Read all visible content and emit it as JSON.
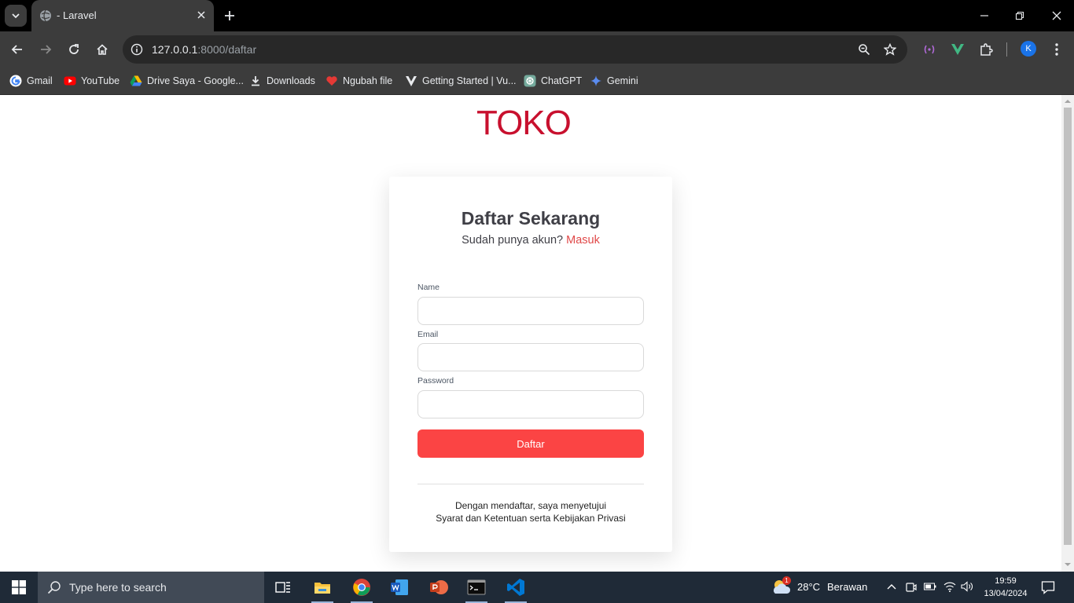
{
  "browser": {
    "tab_title": "- Laravel",
    "url_host": "127.0.0.1",
    "url_rest": ":8000/daftar",
    "profile_initial": "K",
    "bookmarks": [
      {
        "label": "Gmail",
        "icon": "gmail-icon"
      },
      {
        "label": "YouTube",
        "icon": "youtube-icon"
      },
      {
        "label": "Drive Saya - Google...",
        "icon": "google-drive-icon"
      },
      {
        "label": "Downloads",
        "icon": "download-icon"
      },
      {
        "label": "Ngubah file",
        "icon": "heart-icon"
      },
      {
        "label": "Getting Started | Vu...",
        "icon": "vuetify-icon"
      },
      {
        "label": "ChatGPT",
        "icon": "chatgpt-icon"
      },
      {
        "label": "Gemini",
        "icon": "gemini-icon"
      }
    ]
  },
  "page": {
    "logo": "TOKO",
    "title": "Daftar Sekarang",
    "subtitle": "Sudah punya akun?",
    "login_link": "Masuk",
    "fields": {
      "name_label": "Name",
      "email_label": "Email",
      "password_label": "Password"
    },
    "submit_label": "Daftar",
    "terms_line1": "Dengan mendaftar, saya menyetujui",
    "terms_line2": "Syarat dan Ketentuan serta Kebijakan Privasi"
  },
  "taskbar": {
    "search_placeholder": "Type here to search",
    "weather_temp": "28°C",
    "weather_desc": "Berawan",
    "weather_badge": "1",
    "time": "19:59",
    "date": "13/04/2024"
  },
  "colors": {
    "brand": "#c8102e",
    "button": "#fb4444",
    "link": "#e04848"
  }
}
